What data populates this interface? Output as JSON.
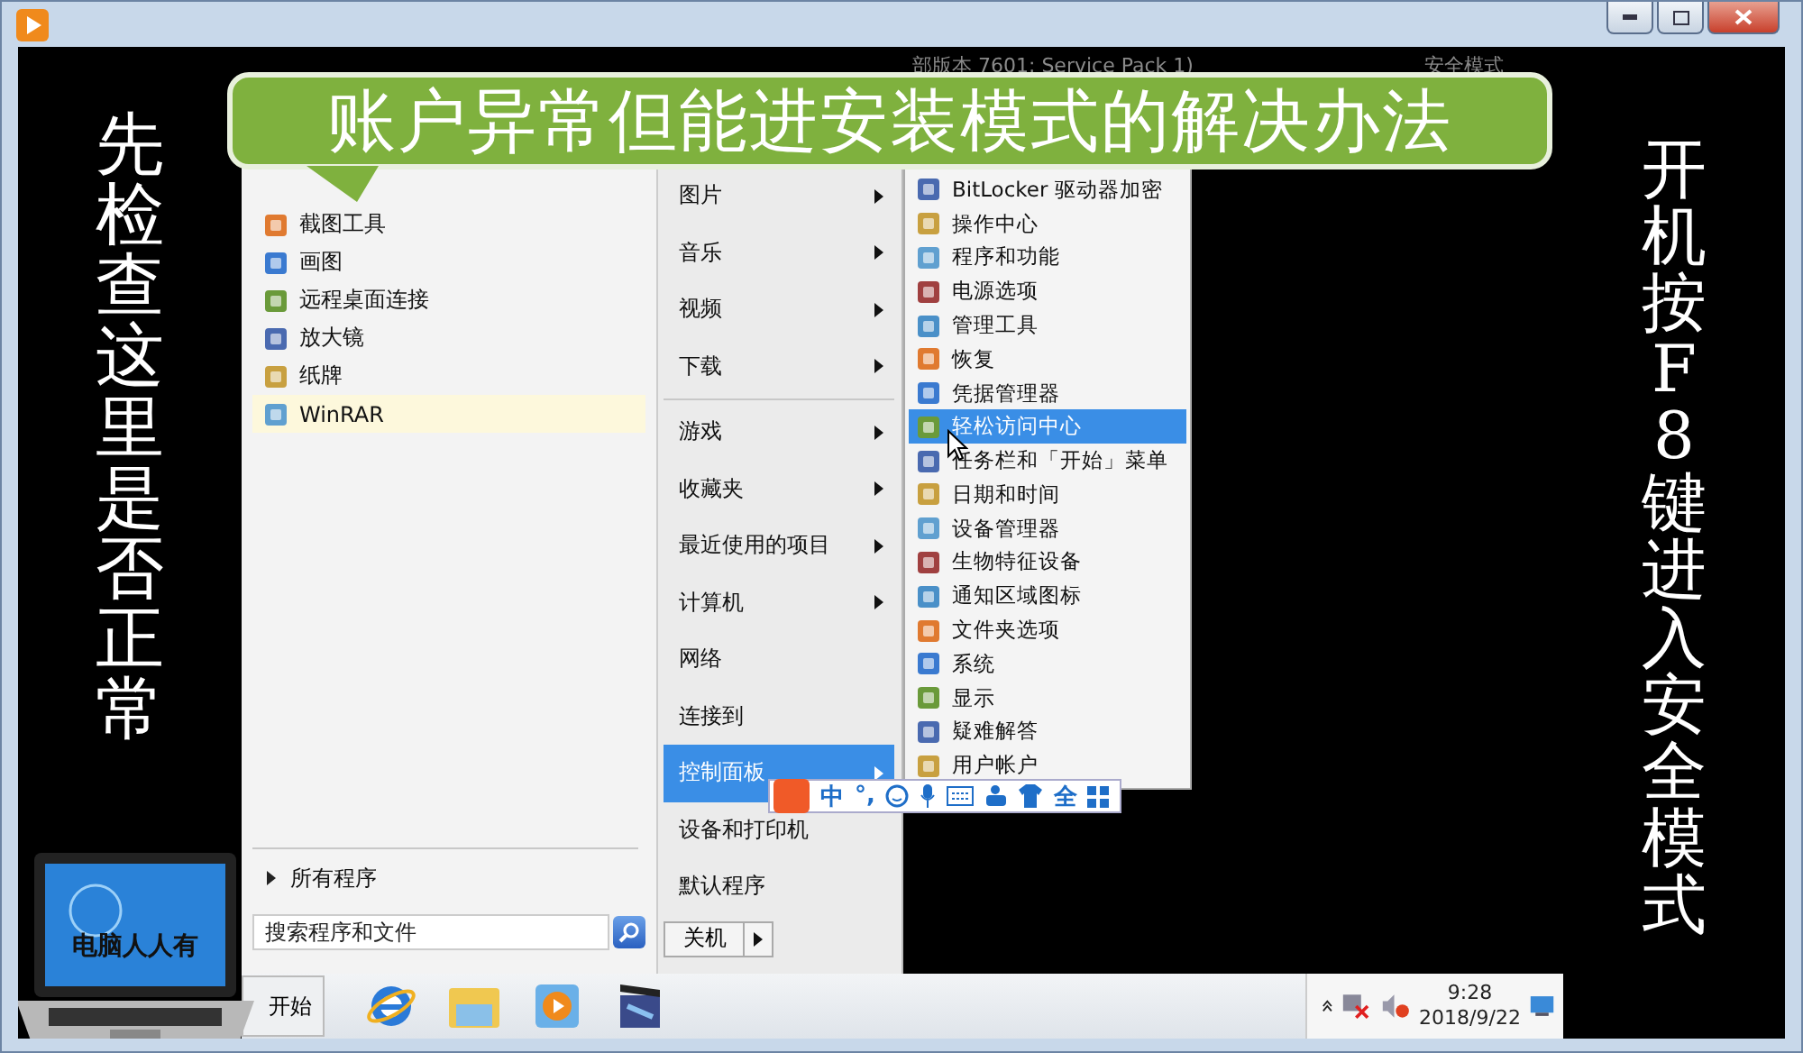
{
  "system_info": {
    "version_text": "部版本 7601: Service Pack 1)",
    "mode_text": "安全模式"
  },
  "banner": {
    "title": "账户异常但能进安装模式的解决办法"
  },
  "left_caption": "先检查这里是否正常",
  "right_caption": "开机按F8键进入安全模式",
  "start_menu": {
    "programs": [
      {
        "label": "截图工具",
        "selected": false
      },
      {
        "label": "画图",
        "selected": false
      },
      {
        "label": "远程桌面连接",
        "selected": false
      },
      {
        "label": "放大镜",
        "selected": false
      },
      {
        "label": "纸牌",
        "selected": false
      },
      {
        "label": "WinRAR",
        "selected": true
      }
    ],
    "all_programs": "所有程序",
    "search": {
      "placeholder": "搜索程序和文件"
    },
    "place_groups": [
      [
        {
          "label": "图片",
          "submenu": true,
          "selected": false
        },
        {
          "label": "音乐",
          "submenu": true,
          "selected": false
        },
        {
          "label": "视频",
          "submenu": true,
          "selected": false
        },
        {
          "label": "下载",
          "submenu": true,
          "selected": false
        }
      ],
      [
        {
          "label": "游戏",
          "submenu": true,
          "selected": false
        },
        {
          "label": "收藏夹",
          "submenu": true,
          "selected": false
        },
        {
          "label": "最近使用的项目",
          "submenu": true,
          "selected": false
        },
        {
          "label": "计算机",
          "submenu": true,
          "selected": false
        },
        {
          "label": "网络",
          "submenu": false,
          "selected": false
        },
        {
          "label": "连接到",
          "submenu": false,
          "selected": false
        },
        {
          "label": "控制面板",
          "submenu": true,
          "selected": true
        },
        {
          "label": "设备和打印机",
          "submenu": false,
          "selected": false
        },
        {
          "label": "默认程序",
          "submenu": false,
          "selected": false
        }
      ]
    ],
    "shutdown": "关机"
  },
  "control_panel_menu": [
    {
      "label": "BitLocker 驱动器加密",
      "selected": false
    },
    {
      "label": "操作中心",
      "selected": false
    },
    {
      "label": "程序和功能",
      "selected": false
    },
    {
      "label": "电源选项",
      "selected": false
    },
    {
      "label": "管理工具",
      "selected": false
    },
    {
      "label": "恢复",
      "selected": false
    },
    {
      "label": "凭据管理器",
      "selected": false
    },
    {
      "label": "轻松访问中心",
      "selected": true
    },
    {
      "label": "任务栏和「开始」菜单",
      "selected": false
    },
    {
      "label": "日期和时间",
      "selected": false
    },
    {
      "label": "设备管理器",
      "selected": false
    },
    {
      "label": "生物特征设备",
      "selected": false
    },
    {
      "label": "通知区域图标",
      "selected": false
    },
    {
      "label": "文件夹选项",
      "selected": false
    },
    {
      "label": "系统",
      "selected": false
    },
    {
      "label": "显示",
      "selected": false
    },
    {
      "label": "疑难解答",
      "selected": false
    },
    {
      "label": "用户帐户",
      "selected": false
    }
  ],
  "ime_bar": {
    "language": "中",
    "punctuation": "°,",
    "width": "全"
  },
  "taskbar": {
    "start": "开始",
    "clock": {
      "time": "9:28",
      "date": "2018/9/22"
    }
  },
  "logo": {
    "text": "电脑人人有"
  }
}
